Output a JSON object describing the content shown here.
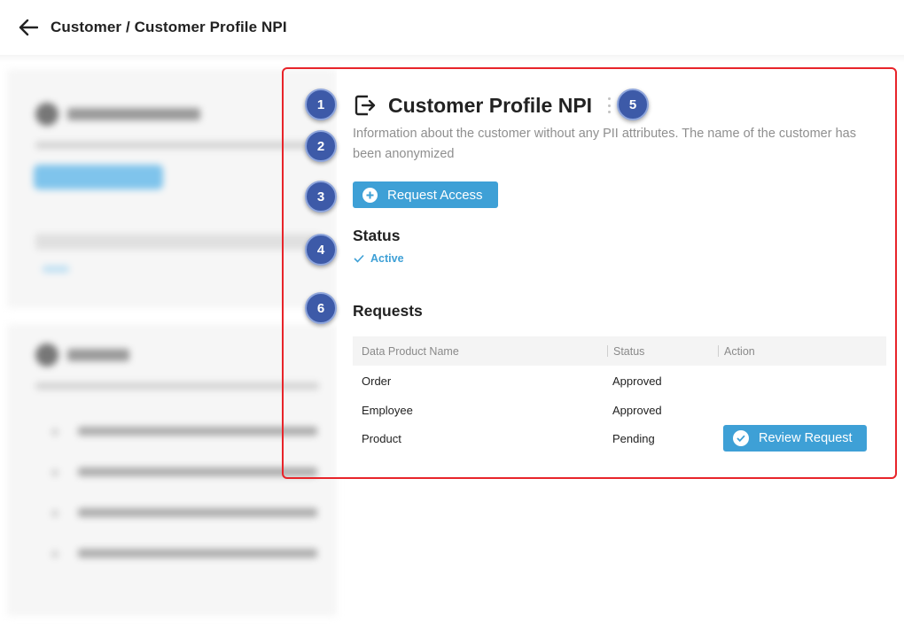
{
  "header": {
    "breadcrumb": "Customer / Customer Profile NPI",
    "back_icon": "arrow-left-icon"
  },
  "product": {
    "title": "Customer Profile NPI",
    "title_icon": "exit-arrow-icon",
    "description": "Information about the customer without any PII attributes. The name of the customer has been anonymized",
    "request_button": "Request Access",
    "status_heading": "Status",
    "status_value": "Active",
    "requests_heading": "Requests"
  },
  "requests": {
    "columns": [
      "Data Product Name",
      "Status",
      "Action"
    ],
    "rows": [
      {
        "name": "Order",
        "status": "Approved",
        "action": ""
      },
      {
        "name": "Employee",
        "status": "Approved",
        "action": ""
      },
      {
        "name": "Product",
        "status": "Pending",
        "action": "Review Request"
      }
    ]
  },
  "callouts": [
    "1",
    "2",
    "3",
    "4",
    "5",
    "6"
  ],
  "colors": {
    "accent": "#3ea0d6",
    "highlight": "#e8242a",
    "callout": "#3d5aa8"
  }
}
